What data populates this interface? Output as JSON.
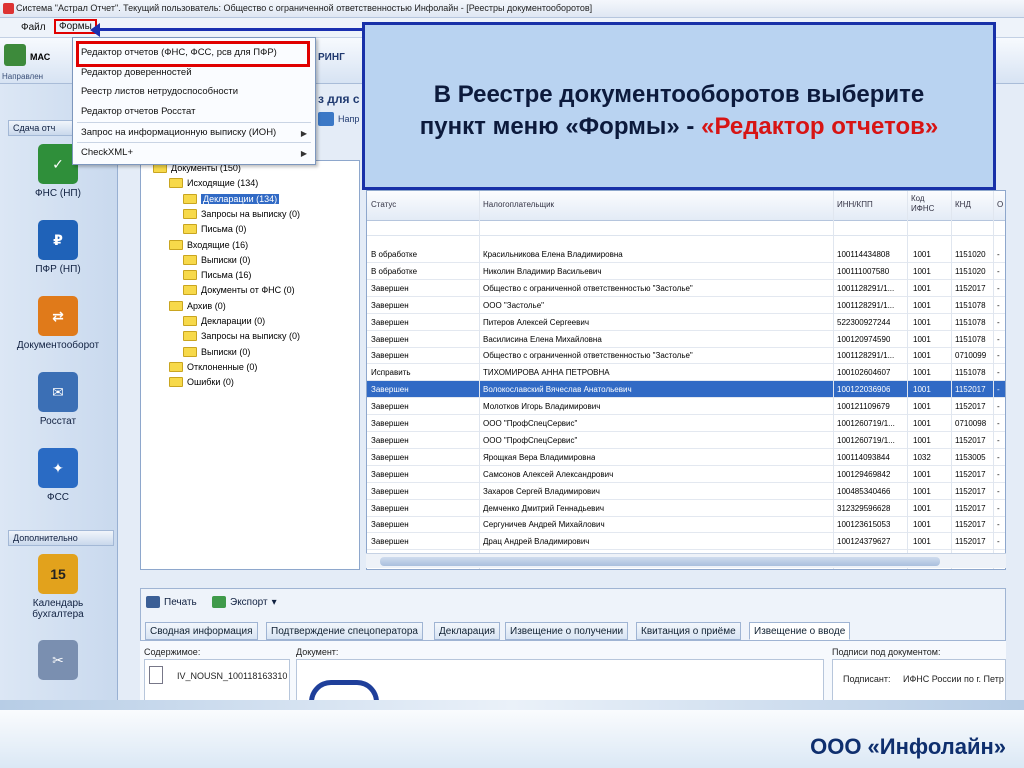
{
  "window": {
    "title": "Система \"Астрал Отчет\". Текущий пользователь: Общество с ограниченной ответственностью Инфолайн - [Реестры документооборотов]"
  },
  "menubar": {
    "items": [
      "Файл",
      "Формы"
    ]
  },
  "ribbon": {
    "left_label": "МАС",
    "right_label": "РИНГ",
    "partial_heading": "з для с",
    "nav_label": "Направлен",
    "send_label": "Напр"
  },
  "dropdown": {
    "items": [
      {
        "label": "Редактор отчетов (ФНС, ФСС, рсв для ПФР)",
        "submenu": false
      },
      {
        "label": "Редактор доверенностей",
        "submenu": false
      },
      {
        "label": "Реестр листов нетрудоспособности",
        "submenu": false
      },
      {
        "label": "Редактор отчетов Росстат",
        "submenu": false
      },
      {
        "label": "Запрос на информационную выписку (ИОН)",
        "submenu": true
      },
      {
        "label": "CheckXML+",
        "submenu": true
      }
    ]
  },
  "sidebar": {
    "header": "Сдача отч",
    "tiles": [
      {
        "label": "ФНС (НП)",
        "icon": "fns-icon",
        "color": "#2f8f3a"
      },
      {
        "label": "ПФР (НП)",
        "icon": "pfr-icon",
        "color": "#1f62b8"
      },
      {
        "label": "Документооборот",
        "icon": "docflow-icon",
        "color": "#e07a1a"
      },
      {
        "label": "Росстат",
        "icon": "rosstat-icon",
        "color": "#3b6fb5"
      },
      {
        "label": "ФСС",
        "icon": "fss-icon",
        "color": "#2a6bc4"
      }
    ],
    "extra_header": "Дополнительно",
    "extra_tiles": [
      {
        "label": "Календарь бухгалтера",
        "icon": "calendar-icon",
        "color": "#e2a21c",
        "glyph": "15"
      }
    ]
  },
  "tree": [
    {
      "label": "Документы (150)",
      "level": 0,
      "selected": false
    },
    {
      "label": "Исходящие (134)",
      "level": 1,
      "selected": false
    },
    {
      "label": "Декларации (134)",
      "level": 2,
      "selected": true
    },
    {
      "label": "Запросы на выписку (0)",
      "level": 2,
      "selected": false
    },
    {
      "label": "Письма (0)",
      "level": 2,
      "selected": false
    },
    {
      "label": "Входящие (16)",
      "level": 1,
      "selected": false
    },
    {
      "label": "Выписки (0)",
      "level": 2,
      "selected": false
    },
    {
      "label": "Письма (16)",
      "level": 2,
      "selected": false
    },
    {
      "label": "Документы от ФНС (0)",
      "level": 2,
      "selected": false
    },
    {
      "label": "Архив (0)",
      "level": 1,
      "selected": false
    },
    {
      "label": "Декларации (0)",
      "level": 2,
      "selected": false
    },
    {
      "label": "Запросы на выписку (0)",
      "level": 2,
      "selected": false
    },
    {
      "label": "Выписки (0)",
      "level": 2,
      "selected": false
    },
    {
      "label": "Отклоненные (0)",
      "level": 1,
      "selected": false
    },
    {
      "label": "Ошибки (0)",
      "level": 1,
      "selected": false
    }
  ],
  "grid": {
    "columns": [
      "Статус",
      "Налогоплательщик",
      "ИНН/КПП",
      "Код ИФНС",
      "КНД",
      "О"
    ],
    "rows": [
      [
        "В обработке",
        "Красильникова Елена Владимировна",
        "100114434808",
        "1001",
        "1151020",
        "-"
      ],
      [
        "В обработке",
        "Николин Владимир Васильевич",
        "100111007580",
        "1001",
        "1151020",
        "-"
      ],
      [
        "Завершен",
        "Общество с ограниченной ответственностью \"Застолье\"",
        "1001128291/1...",
        "1001",
        "1152017",
        "-"
      ],
      [
        "Завершен",
        "ООО \"Застолье\"",
        "1001128291/1...",
        "1001",
        "1151078",
        "-"
      ],
      [
        "Завершен",
        "Питеров Алексей Сергеевич",
        "522300927244",
        "1001",
        "1151078",
        "-"
      ],
      [
        "Завершен",
        "Василисина Елена Михайловна",
        "100120974590",
        "1001",
        "1151078",
        "-"
      ],
      [
        "Завершен",
        "Общество с ограниченной ответственностью \"Застолье\"",
        "1001128291/1...",
        "1001",
        "0710099",
        "-"
      ],
      [
        "Исправить",
        "ТИХОМИРОВА АННА ПЕТРОВНА",
        "100102604607",
        "1001",
        "1151078",
        "-"
      ],
      [
        "Завершен",
        "Волокославский Вячеслав Анатольевич",
        "100122036906",
        "1001",
        "1152017",
        "-"
      ],
      [
        "Завершен",
        "Молотков Игорь Владимирович",
        "100121109679",
        "1001",
        "1152017",
        "-"
      ],
      [
        "Завершен",
        "ООО \"ПрофСпецСервис\"",
        "1001260719/1...",
        "1001",
        "0710098",
        "-"
      ],
      [
        "Завершен",
        "ООО \"ПрофСпецСервис\"",
        "1001260719/1...",
        "1001",
        "1152017",
        "-"
      ],
      [
        "Завершен",
        "Ярощкая Вера Владимировна",
        "100114093844",
        "1032",
        "1153005",
        "-"
      ],
      [
        "Завершен",
        "Самсонов Алексей Александрович",
        "100129469842",
        "1001",
        "1152017",
        "-"
      ],
      [
        "Завершен",
        "Захаров Сергей Владимирович",
        "100485340466",
        "1001",
        "1152017",
        "-"
      ],
      [
        "Завершен",
        "Демченко Дмитрий Геннадьевич",
        "312329596628",
        "1001",
        "1152017",
        "-"
      ],
      [
        "Завершен",
        "Сергуничев Андрей Михайлович",
        "100123615053",
        "1001",
        "1152017",
        "-"
      ],
      [
        "Завершен",
        "Драц Андрей Владимирович",
        "100124379627",
        "1001",
        "1152017",
        "-"
      ]
    ],
    "selected_row": 8
  },
  "bottom": {
    "print_label": "Печать",
    "export_label": "Экспорт",
    "tabs": [
      "Сводная информация",
      "Подтверждение спецоператора",
      "Декларация",
      "Извещение о получении",
      "Квитанция о приёме",
      "Извещение о вводе"
    ],
    "active_tab": 5,
    "contents_label": "Содержимое:",
    "file_name": "IV_NOUSN_100118163310",
    "document_label": "Документ:",
    "signatures_label": "Подписи под документом:",
    "signer_label": "Подписант:",
    "signer_value": "ИФНС России по г. Петр"
  },
  "callout": {
    "line1": "В Реестре документооборотов выберите",
    "line2_prefix": "пункт меню «Формы» - ",
    "line2_highlight": "«Редактор отчетов»"
  },
  "footer": {
    "brand": "ООО «Инфолайн»"
  }
}
